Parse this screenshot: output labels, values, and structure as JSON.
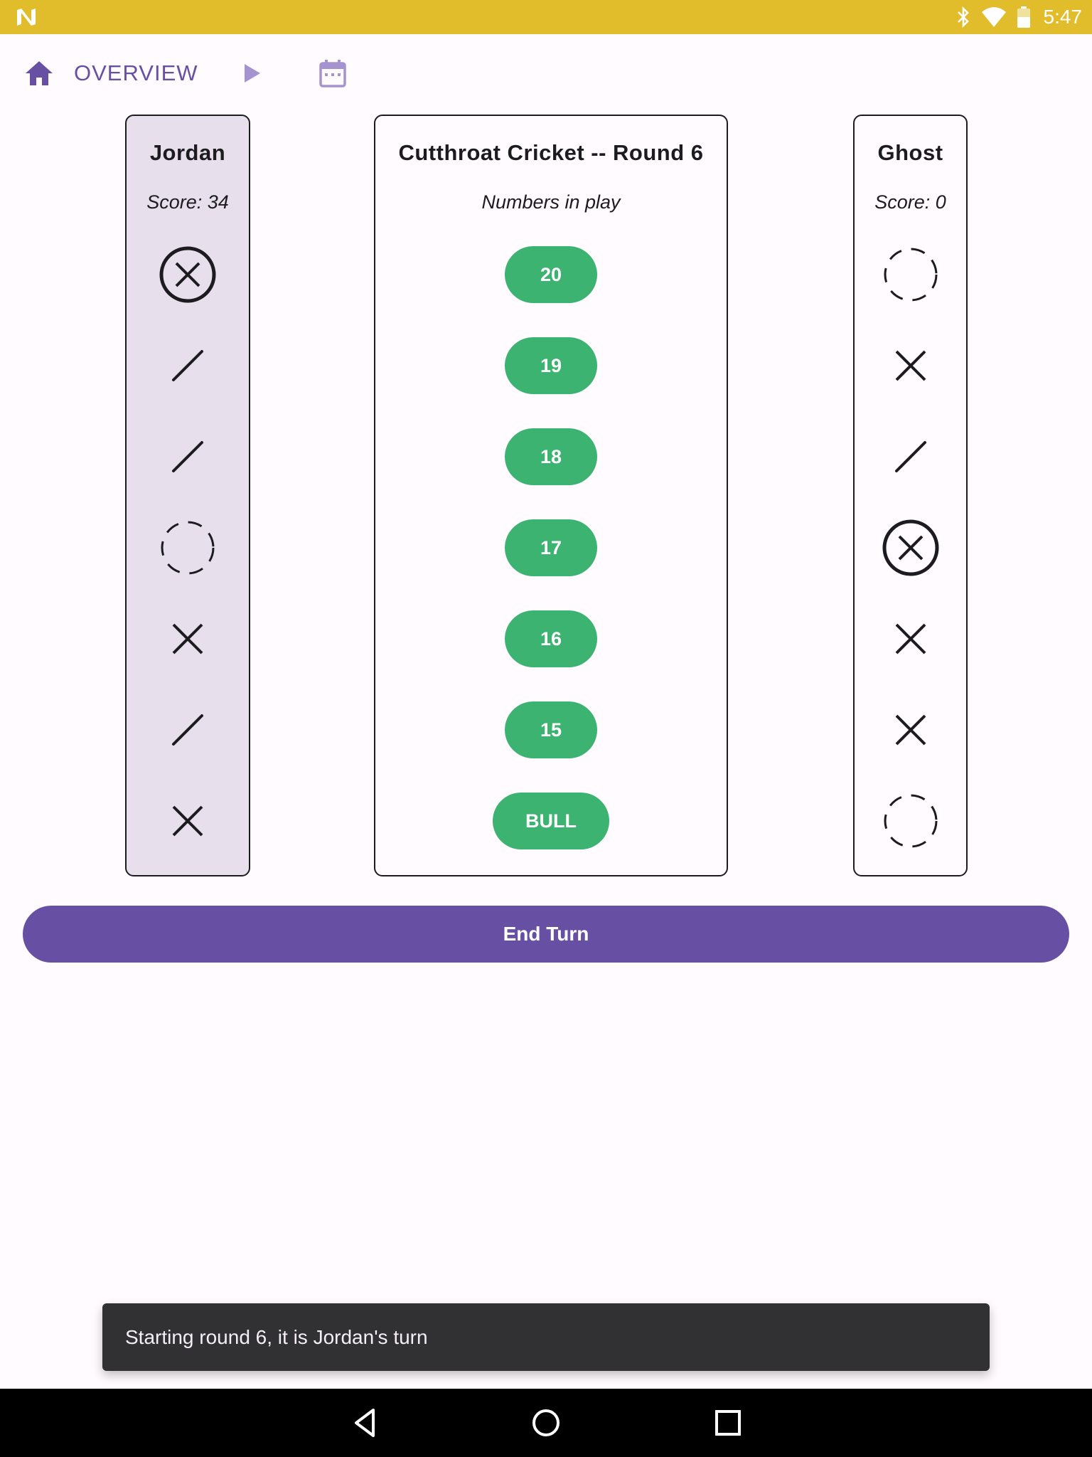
{
  "status_bar": {
    "time": "5:47",
    "icons": [
      "n-logo-icon",
      "bluetooth-icon",
      "wifi-icon",
      "battery-icon"
    ]
  },
  "nav": {
    "home_icon": "home-icon",
    "overview_label": "OVERVIEW",
    "play_icon": "play-icon",
    "calendar_icon": "calendar-icon",
    "accent_color": "#6750a4"
  },
  "game": {
    "title": "Cutthroat Cricket -- Round 6",
    "subtitle": "Numbers in play",
    "numbers": [
      "20",
      "19",
      "18",
      "17",
      "16",
      "15",
      "BULL"
    ],
    "number_color": "#3cb371"
  },
  "players": [
    {
      "name": "Jordan",
      "score_text": "Score: 34",
      "active": true,
      "marks": [
        "closed",
        "one",
        "one",
        "none",
        "two",
        "one",
        "two"
      ]
    },
    {
      "name": "Ghost",
      "score_text": "Score: 0",
      "active": false,
      "marks": [
        "none",
        "two",
        "one",
        "closed",
        "two",
        "two",
        "none"
      ]
    }
  ],
  "actions": {
    "end_turn_label": "End Turn"
  },
  "snackbar": {
    "message": "Starting round 6, it is Jordan's turn"
  },
  "system_nav": {
    "icons": [
      "back-icon",
      "home-circle-icon",
      "recents-icon"
    ]
  }
}
